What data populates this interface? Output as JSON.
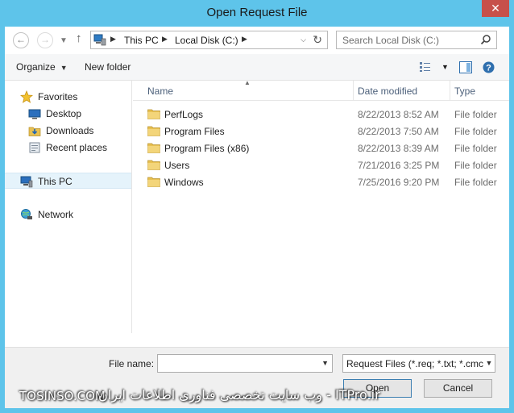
{
  "window": {
    "title": "Open Request File",
    "close_glyph": "✕"
  },
  "nav": {
    "back_icon": "back-arrow-icon",
    "forward_icon": "forward-arrow-icon",
    "up_icon": "up-arrow-icon",
    "breadcrumb": [
      "This PC",
      "Local Disk (C:)"
    ],
    "search_placeholder": "Search Local Disk (C:)"
  },
  "toolbar": {
    "organize_label": "Organize",
    "new_folder_label": "New folder"
  },
  "sidebar": {
    "items": [
      {
        "label": "Favorites",
        "icon": "star-icon"
      },
      {
        "label": "Desktop",
        "icon": "desktop-icon"
      },
      {
        "label": "Downloads",
        "icon": "downloads-icon"
      },
      {
        "label": "Recent places",
        "icon": "recent-places-icon"
      },
      {
        "label": "This PC",
        "icon": "computer-icon"
      },
      {
        "label": "Network",
        "icon": "network-icon"
      }
    ]
  },
  "filelist": {
    "columns": [
      "Name",
      "Date modified",
      "Type"
    ],
    "rows": [
      {
        "name": "PerfLogs",
        "date": "8/22/2013 8:52 AM",
        "type": "File folder"
      },
      {
        "name": "Program Files",
        "date": "8/22/2013 7:50 AM",
        "type": "File folder"
      },
      {
        "name": "Program Files (x86)",
        "date": "8/22/2013 8:39 AM",
        "type": "File folder"
      },
      {
        "name": "Users",
        "date": "7/21/2016 3:25 PM",
        "type": "File folder"
      },
      {
        "name": "Windows",
        "date": "7/25/2016 9:20 PM",
        "type": "File folder"
      }
    ]
  },
  "bottom": {
    "file_name_label": "File name:",
    "file_name_value": "",
    "filter_value": "Request Files (*.req; *.txt; *.cmc",
    "open_label": "Open",
    "cancel_label": "Cancel"
  },
  "watermark": {
    "left_text": "TOSINSO.COM",
    "right_text": "وب سایت تخصصی فناوری اطلاعات ایران - ITPro.ir"
  },
  "colors": {
    "frame": "#5ec4ea",
    "close_button": "#c7504a",
    "selection": "#e5f3fb",
    "header_text": "#4c607a"
  }
}
